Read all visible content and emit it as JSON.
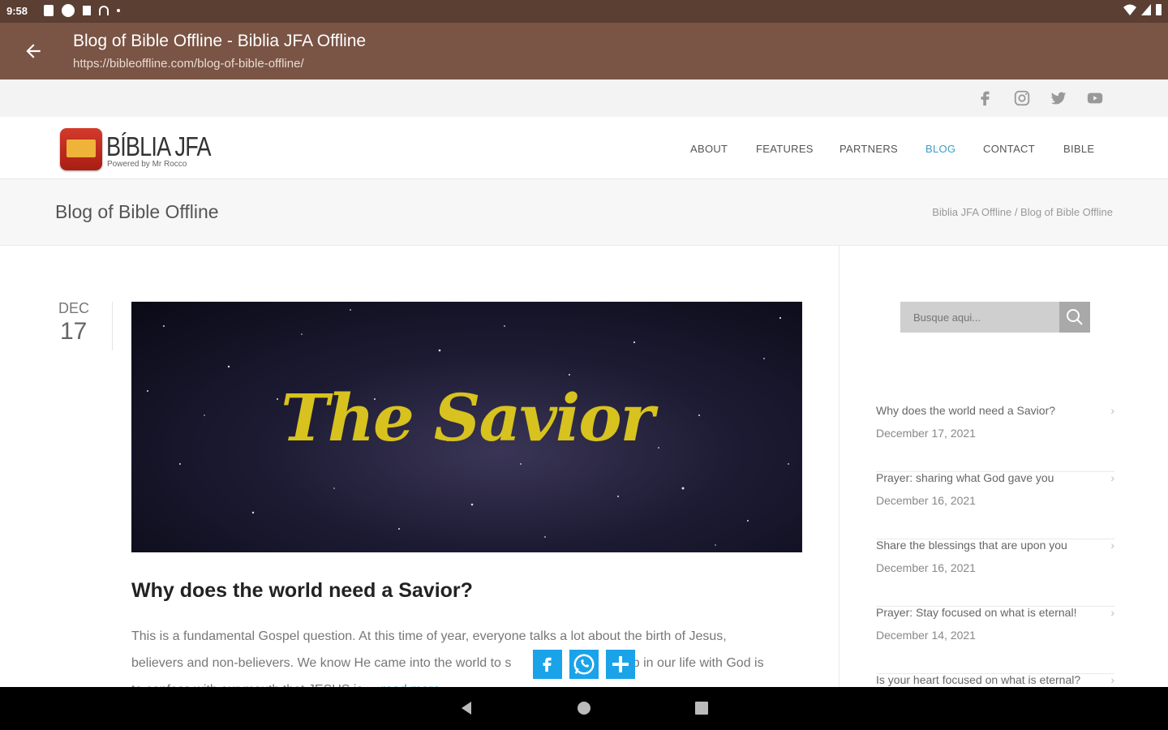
{
  "status": {
    "time": "9:58"
  },
  "toolbar": {
    "title": "Blog of Bible Offline - Biblia JFA Offline",
    "url": "https://bibleoffline.com/blog-of-bible-offline/"
  },
  "header": {
    "logo_text": "BÍBLIA JFA",
    "logo_sub": "Powered by Mr Rocco",
    "nav": [
      "ABOUT",
      "FEATURES",
      "PARTNERS",
      "BLOG",
      "CONTACT",
      "BIBLE"
    ]
  },
  "page": {
    "title": "Blog of Bible Offline",
    "breadcrumb": "Biblia JFA Offline / Blog of Bible Offline"
  },
  "post": {
    "month": "DEC",
    "day": "17",
    "image_text": "The Savior",
    "heading": "Why does the world need a Savior?",
    "excerpt_line1": "This is a fundamental Gospel question. At this time of year, everyone talks a lot about the birth of Jesus,",
    "excerpt_line2": "believers and non-believers. We know He came into the world to s",
    "excerpt_line2_end": "step in our life with God is",
    "excerpt_line3": "to confess with our mouth that JESUS is ...",
    "read_more": "read more"
  },
  "sidebar": {
    "search_placeholder": "Busque aqui...",
    "recent": [
      {
        "title": "Why does the world need a Savior?",
        "date": "December 17, 2021"
      },
      {
        "title": "Prayer: sharing what God gave you",
        "date": "December 16, 2021"
      },
      {
        "title": "Share the blessings that are upon you",
        "date": "December 16, 2021"
      },
      {
        "title": "Prayer: Stay focused on what is eternal!",
        "date": "December 14, 2021"
      },
      {
        "title": "Is your heart focused on what is eternal?",
        "date": ""
      }
    ]
  },
  "colors": {
    "toolbar": "#7a5444",
    "statusbar": "#5b3f33",
    "accent": "#3aa0c8",
    "share": "#1aa3e8"
  },
  "icons": {
    "social": [
      "facebook-icon",
      "instagram-icon",
      "twitter-icon",
      "youtube-icon"
    ],
    "share": [
      "facebook-share-icon",
      "whatsapp-share-icon",
      "plus-share-icon"
    ]
  }
}
